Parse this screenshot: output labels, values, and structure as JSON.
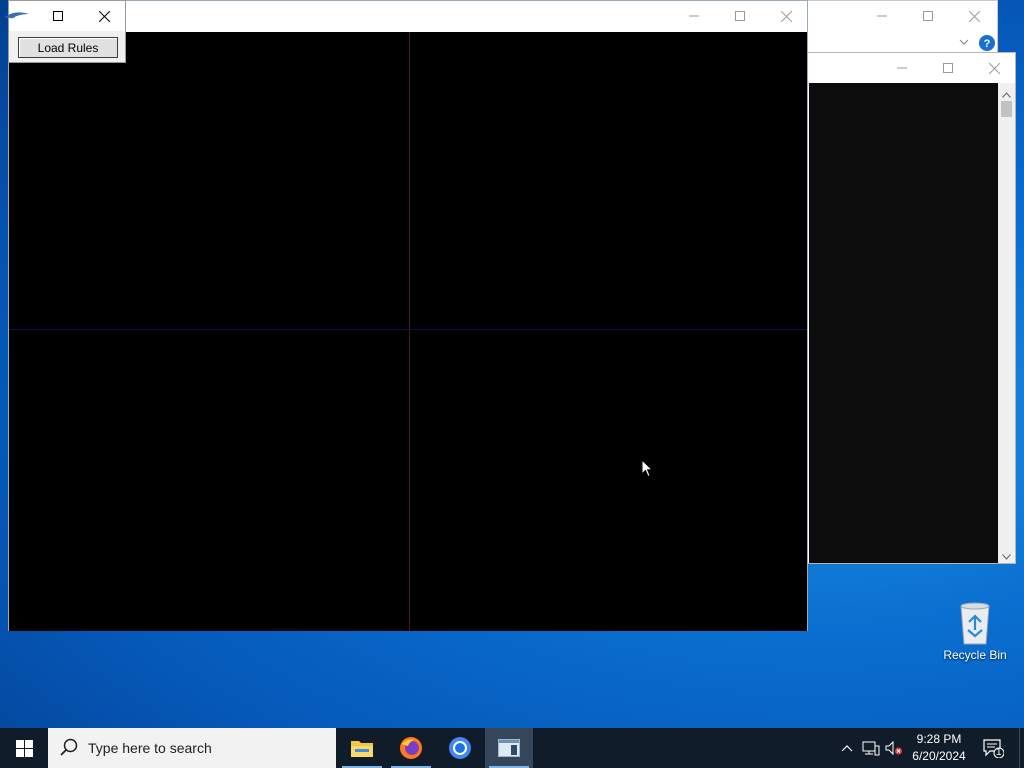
{
  "tool_window": {
    "button_label": "Load Rules"
  },
  "desktop": {
    "recycle_bin_label": "Recycle Bin"
  },
  "taskbar": {
    "search_placeholder": "Type here to search",
    "time": "9:28 PM",
    "date": "6/20/2024",
    "notification_count": "1"
  },
  "colors": {
    "canvas": "#000000",
    "vertical_axis": "#5a1418",
    "horizontal_axis": "#0e0e5a",
    "taskbar": "#101c2a"
  }
}
